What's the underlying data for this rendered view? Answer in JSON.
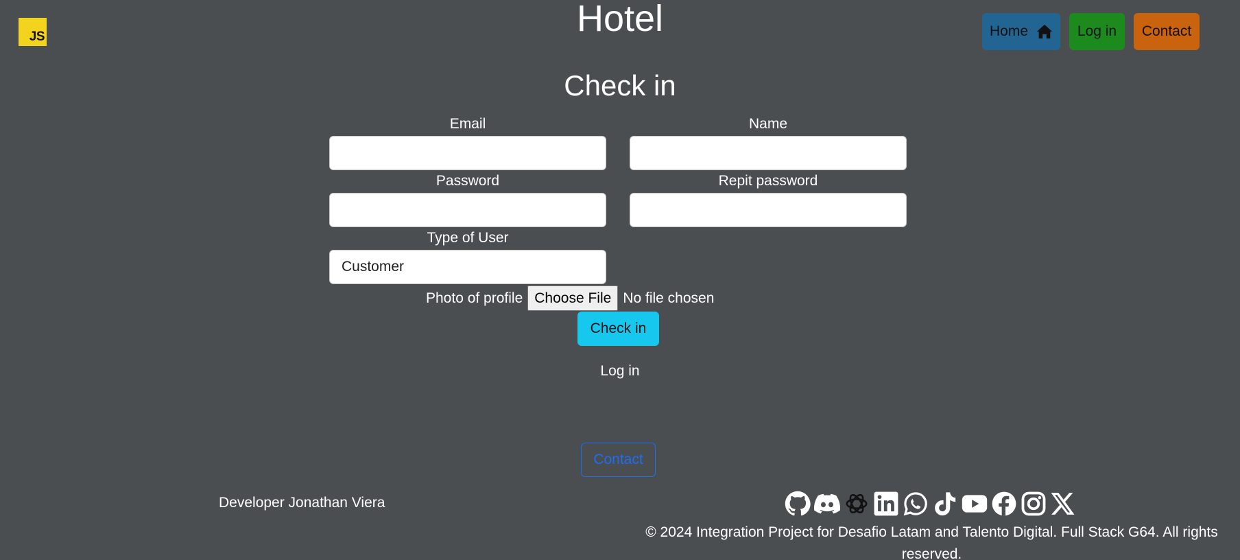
{
  "header": {
    "logo_text": "JS",
    "title": "Hotel",
    "nav": {
      "home": "Home",
      "login": "Log in",
      "contact": "Contact"
    },
    "colors": {
      "home": "#236592",
      "login": "#1d8a1d",
      "contact": "#c9630e"
    }
  },
  "form": {
    "heading": "Check in",
    "email_label": "Email",
    "email_value": "",
    "name_label": "Name",
    "name_value": "",
    "password_label": "Password",
    "password_value": "",
    "repeat_password_label": "Repit password",
    "repeat_password_value": "",
    "user_type_label": "Type of User",
    "user_type_value": "Customer",
    "photo_label": "Photo of profile",
    "file_button": "Choose File",
    "file_status": "No file chosen",
    "submit": "Check in",
    "login_link": "Log in"
  },
  "footer": {
    "contact_button": "Contact",
    "developer": "Developer Jonathan Viera",
    "social_icons": [
      "github-icon",
      "discord-icon",
      "openai-icon",
      "linkedin-icon",
      "whatsapp-icon",
      "tiktok-icon",
      "youtube-icon",
      "facebook-icon",
      "instagram-icon",
      "x-icon"
    ],
    "copyright": "© 2024 Integration Project for Desafio Latam and Talento Digital. Full Stack G64. All rights reserved."
  }
}
